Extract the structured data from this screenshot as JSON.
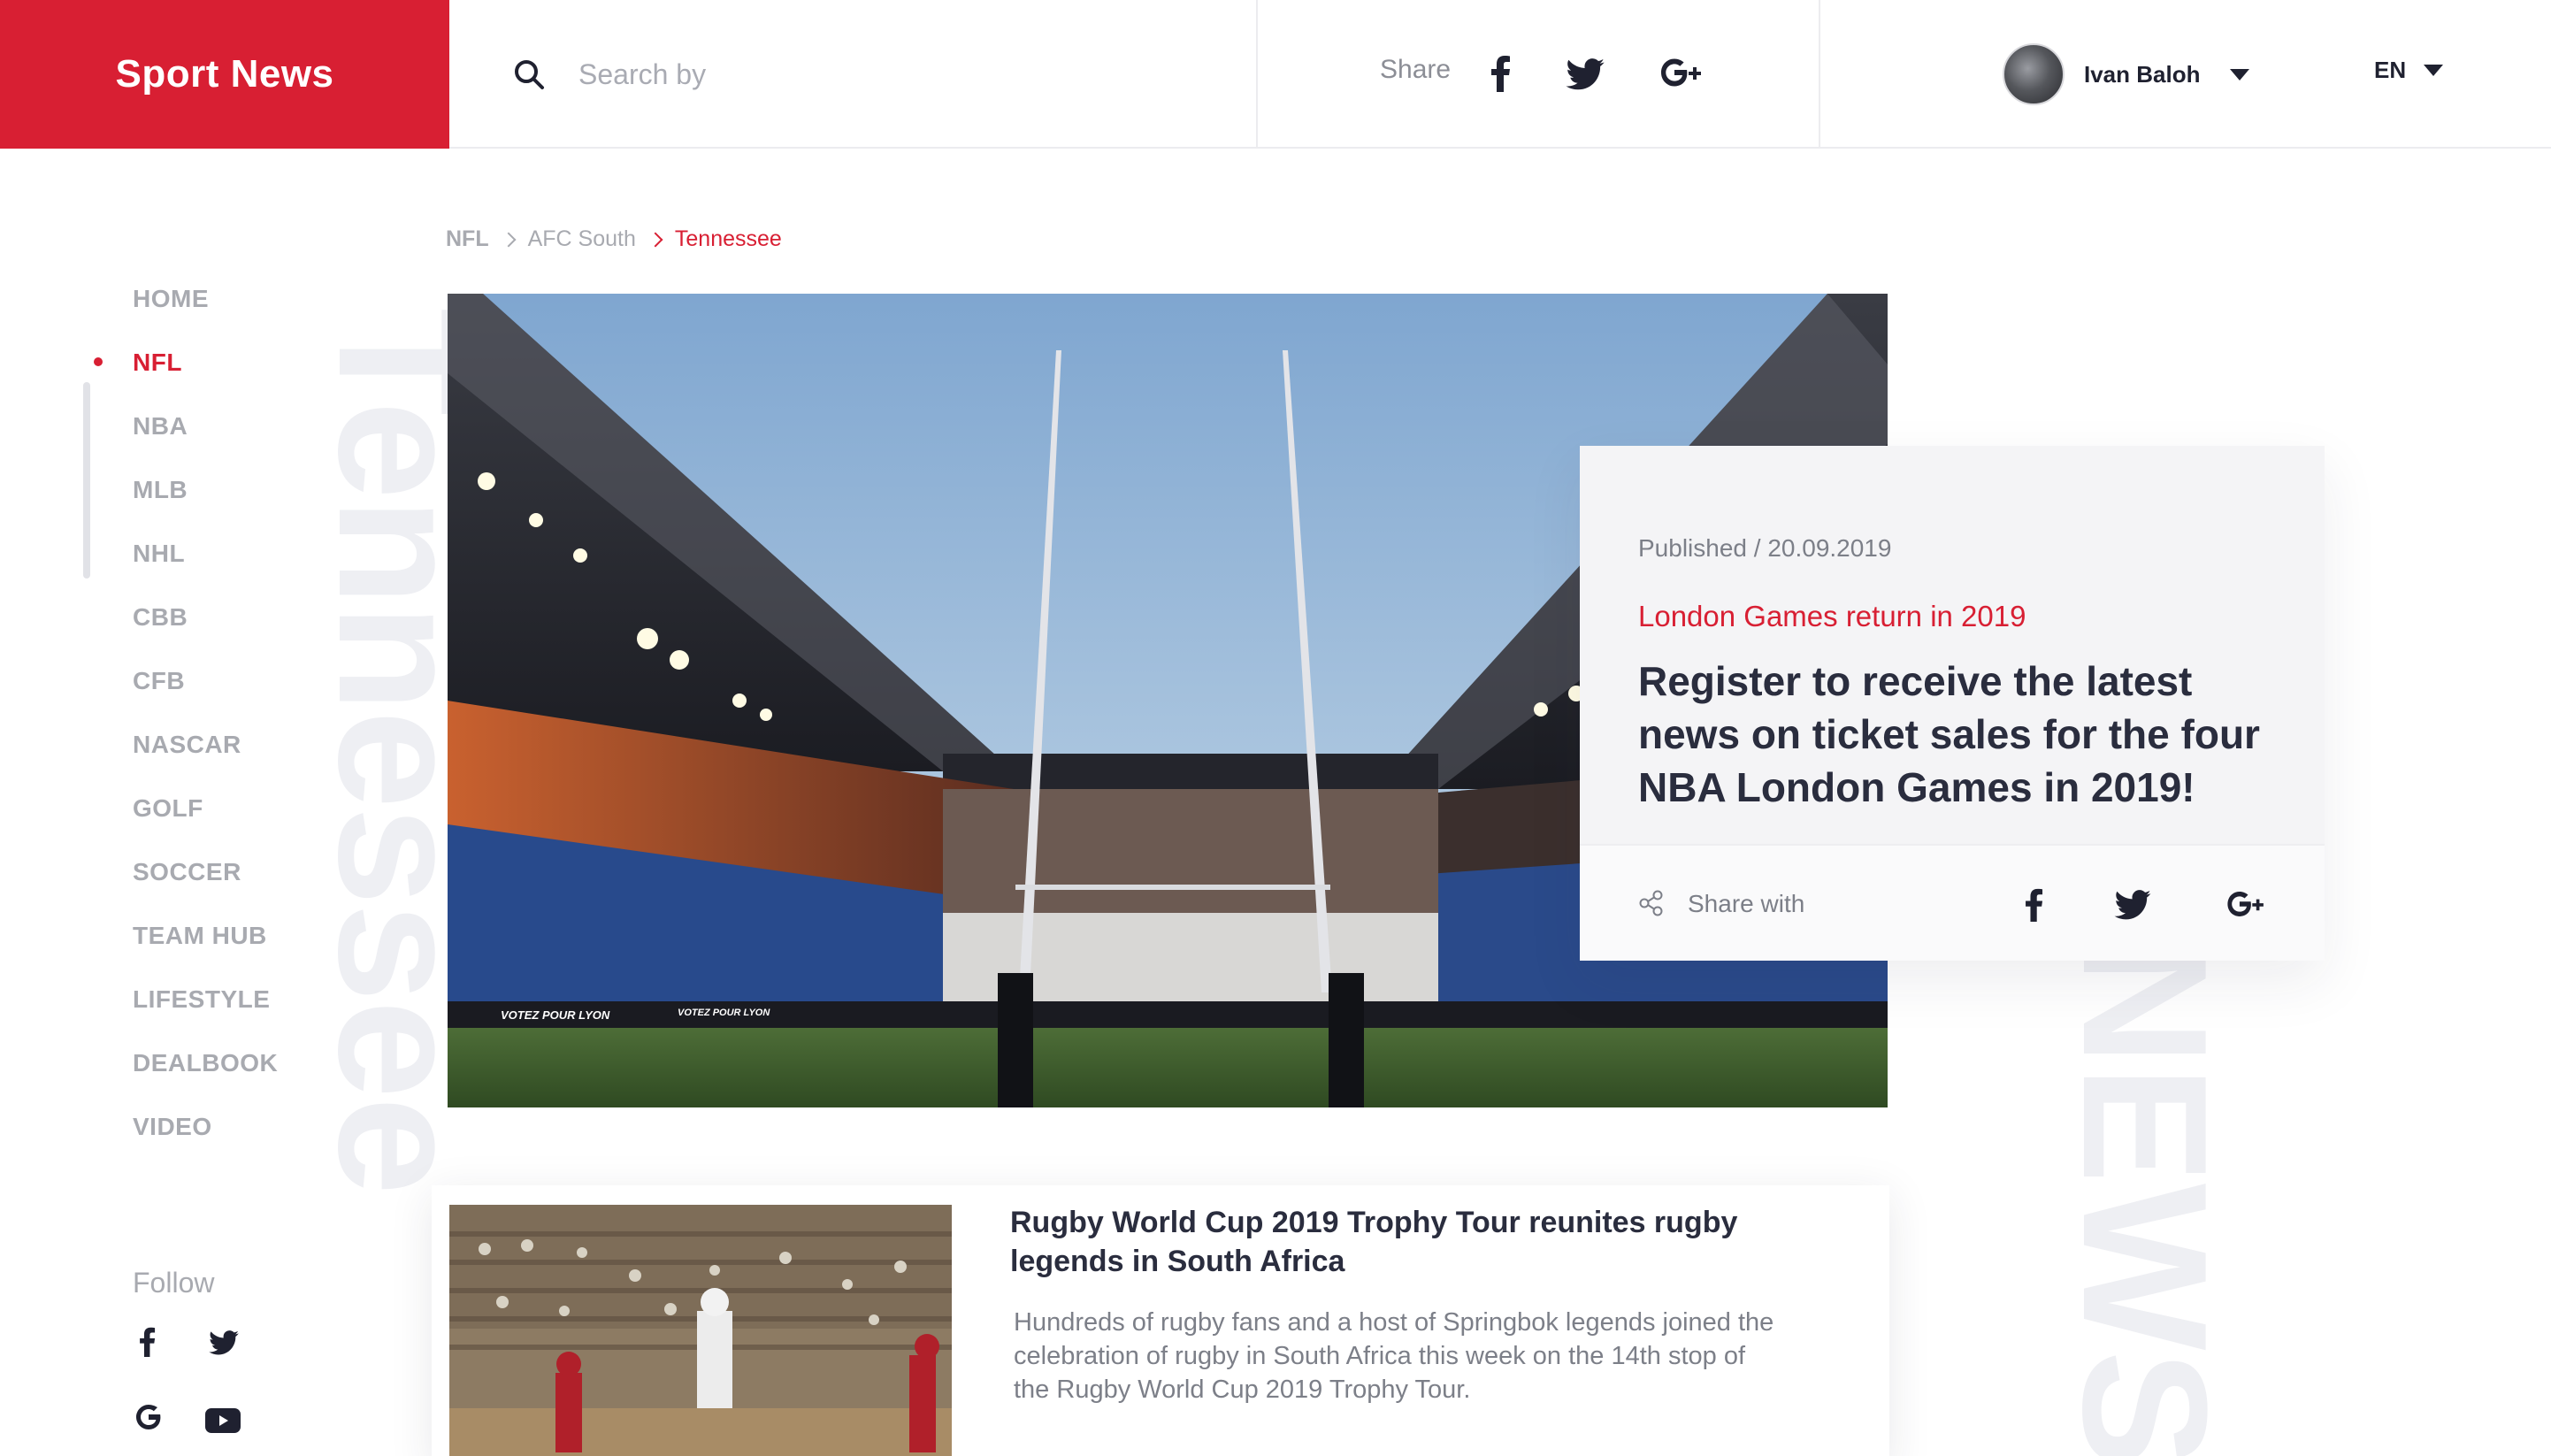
{
  "header": {
    "brand": "Sport News",
    "search_placeholder": "Search by",
    "share_label": "Share",
    "share_icons": [
      "facebook-icon",
      "twitter-icon",
      "google-plus-icon"
    ],
    "user_name": "Ivan Baloh",
    "language": "EN"
  },
  "sidebar": {
    "items": [
      {
        "label": "HOME",
        "active": false
      },
      {
        "label": "NFL",
        "active": true
      },
      {
        "label": "NBA",
        "active": false
      },
      {
        "label": "MLB",
        "active": false
      },
      {
        "label": "NHL",
        "active": false
      },
      {
        "label": "CBB",
        "active": false
      },
      {
        "label": "CFB",
        "active": false
      },
      {
        "label": "NASCAR",
        "active": false
      },
      {
        "label": "GOLF",
        "active": false
      },
      {
        "label": "SOCCER",
        "active": false
      },
      {
        "label": "TEAM HUB",
        "active": false
      },
      {
        "label": "LIFESTYLE",
        "active": false
      },
      {
        "label": "DEALBOOK",
        "active": false
      },
      {
        "label": "VIDEO",
        "active": false
      }
    ],
    "follow_label": "Follow",
    "follow_icons": [
      "facebook-icon",
      "twitter-icon",
      "google-icon",
      "youtube-icon"
    ]
  },
  "watermarks": {
    "left": "Tennessee",
    "right": "NEWS"
  },
  "breadcrumb": [
    "NFL",
    "AFC South",
    "Tennessee"
  ],
  "featured": {
    "meta": "Published / 20.09.2019",
    "kicker": "London Games return in 2019",
    "title": "Register to receive the latest news on ticket sales for the four NBA London Games in 2019!",
    "share_label": "Share with",
    "share_icons": [
      "facebook-icon",
      "twitter-icon",
      "google-plus-icon"
    ],
    "hero_banners": [
      "VOTEZ POUR LYON",
      "VOTEZ POUR LYON"
    ]
  },
  "article": {
    "title": "Rugby World Cup 2019 Trophy Tour reunites rugby legends in South Africa",
    "body": "Hundreds of rugby fans and a host of Springbok legends joined the celebration of rugby in South Africa this week on the 14th stop of the Rugby World Cup 2019 Trophy Tour."
  },
  "colors": {
    "accent": "#d81f33",
    "text_dark": "#2a2d3e",
    "text_muted": "#a8aab0",
    "card_bg": "#f4f4f6"
  }
}
